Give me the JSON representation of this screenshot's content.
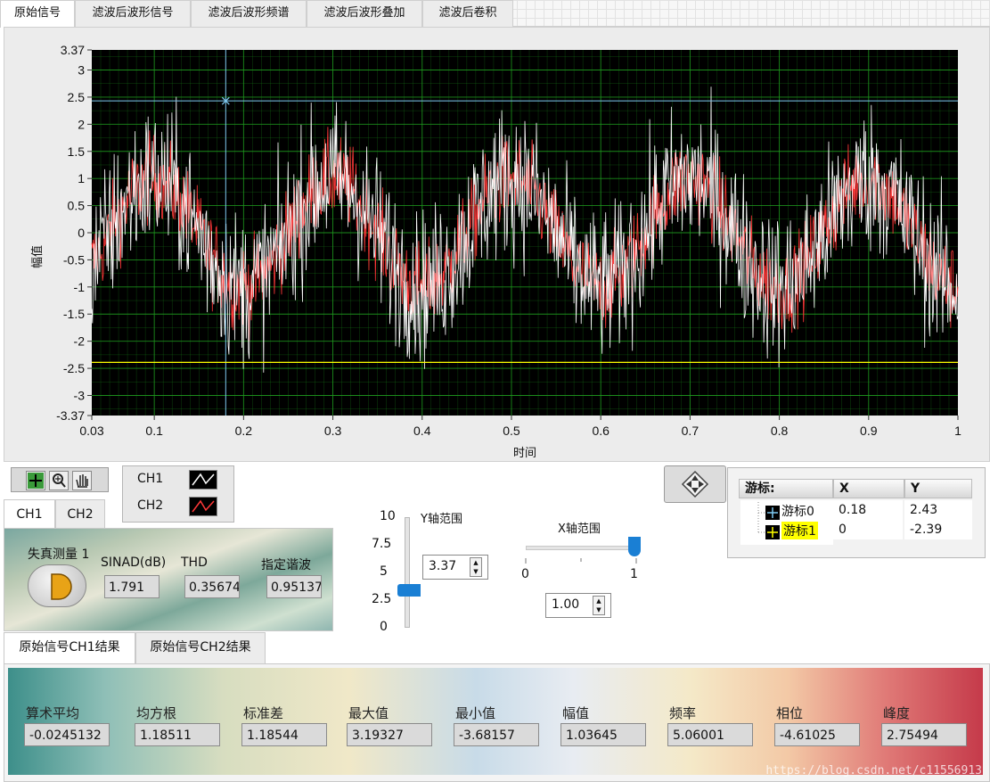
{
  "tabs": [
    "原始信号",
    "滤波后波形信号",
    "滤波后波形频谱",
    "滤波后波形叠加",
    "滤波后卷积"
  ],
  "colors": {
    "plot_bg": "#000000",
    "grid": "#1e9a1e",
    "ch1": "#ffffff",
    "ch2": "#ff3838",
    "cursor0": "#7ec8f0",
    "cursor1": "#ffff00",
    "slider": "#1a7fd4"
  },
  "chart_data": {
    "type": "line",
    "title": "",
    "xlabel": "时间",
    "ylabel": "幅值",
    "xlim": [
      0.03,
      1
    ],
    "ylim": [
      -3.37,
      3.37
    ],
    "x_ticks": [
      "0.03",
      "0.1",
      "0.2",
      "0.3",
      "0.4",
      "0.5",
      "0.6",
      "0.7",
      "0.8",
      "0.9",
      "1"
    ],
    "y_ticks": [
      "3.37",
      "3",
      "2.5",
      "2",
      "1.5",
      "1",
      "0.5",
      "0",
      "-0.5",
      "-1",
      "-1.5",
      "-2",
      "-2.5",
      "-3",
      "-3.37"
    ],
    "grid": true,
    "series": [
      {
        "name": "CH1",
        "color": "#ffffff",
        "period": 0.1,
        "phase": 0.05,
        "amplitude": 1,
        "noise_sd": 0.7
      },
      {
        "name": "CH2",
        "color": "#ff3838",
        "period": 0.1,
        "phase": 0.05,
        "amplitude": 1,
        "noise_sd": 0.4
      }
    ],
    "cursors": [
      {
        "name": "游标0",
        "x": 0.18,
        "y": 2.43,
        "color": "#7ec8f0"
      },
      {
        "name": "游标1",
        "x": 0,
        "y": -2.39,
        "color": "#ffff00"
      }
    ]
  },
  "palette": {
    "icons": [
      "cursor-move-icon",
      "zoom-icon",
      "pan-hand-icon"
    ]
  },
  "legend": [
    {
      "label": "CH1"
    },
    {
      "label": "CH2"
    }
  ],
  "cursor_table": {
    "headers": [
      "游标:",
      "X",
      "Y"
    ],
    "rows": [
      {
        "name": "游标0",
        "x": "0.18",
        "y": "2.43"
      },
      {
        "name": "游标1",
        "x": "0",
        "y": "-2.39"
      }
    ]
  },
  "ch_tabs": [
    "CH1",
    "CH2"
  ],
  "distortion": {
    "title": "失真测量 1",
    "sinad_label": "SINAD(dB)",
    "sinad": "1.791",
    "thd_label": "THD",
    "thd": "0.356747",
    "harm_label": "指定谐波",
    "harm": "0.95137"
  },
  "y_range": {
    "label": "Y轴范围",
    "value": "3.37",
    "scale": [
      "10",
      "7.5",
      "5",
      "2.5",
      "0"
    ],
    "slider_value": 3.37,
    "max": 10
  },
  "x_range": {
    "label": "X轴范围",
    "value": "1.00",
    "scale": [
      "0",
      "1"
    ],
    "slider_value": 1.0
  },
  "result_tabs": [
    "原始信号CH1结果",
    "原始信号CH2结果"
  ],
  "results": [
    {
      "label": "算术平均",
      "value": "-0.0245132"
    },
    {
      "label": "均方根",
      "value": "1.18511"
    },
    {
      "label": "标准差",
      "value": "1.18544"
    },
    {
      "label": "最大值",
      "value": "3.19327"
    },
    {
      "label": "最小值",
      "value": "-3.68157"
    },
    {
      "label": "幅值",
      "value": "1.03645"
    },
    {
      "label": "频率",
      "value": "5.06001"
    },
    {
      "label": "相位",
      "value": "-4.61025"
    },
    {
      "label": "峰度",
      "value": "2.75494"
    }
  ],
  "watermark": "https://blog.csdn.net/c11556913"
}
